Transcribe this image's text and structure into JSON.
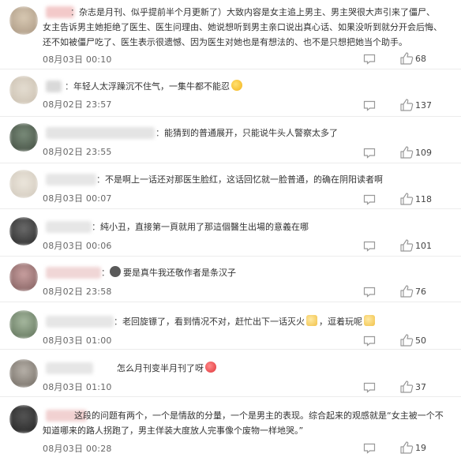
{
  "comments": [
    {
      "name_sep": "：",
      "text_lines": [
        "杂志是月刊、似乎提前半个月更新了）大致内容是女主追上男主、男主哭很大声引来了僵尸、",
        "女主告诉男主她拒绝了医生、医生问理由、她说想听到男主亲口说出真心话、如果没听到就分开会后悔、",
        "还不如被僵尸吃了、医生表示很遗憾、因为医生对她也是有想法的、也不是只想把她当个助手。"
      ],
      "date": "08月03日 00:10",
      "likes": "68"
    },
    {
      "name_sep": "：",
      "text_lines": [
        "年轻人太浮躁沉不住气，一集牛都不能忍"
      ],
      "emoji": "sad-face-emoji",
      "date": "08月02日 23:57",
      "likes": "137"
    },
    {
      "name_sep": "：",
      "text_lines": [
        "能猜到的普通展开，只能说牛头人警察太多了"
      ],
      "date": "08月02日 23:55",
      "likes": "109"
    },
    {
      "name_sep": "：",
      "text_lines": [
        "不是啊上一话还对那医生脸红，这话回忆就一脸普通，的确在阴阳读者啊"
      ],
      "date": "08月03日 00:07",
      "likes": "118"
    },
    {
      "name_sep": "：",
      "text_lines": [
        "純小丑，直接第一頁就用了那這個醫生出場的意義在哪"
      ],
      "date": "08月03日 00:06",
      "likes": "101"
    },
    {
      "name_sep": "：",
      "text_lines": [
        "要是真牛我还敬作者是条汉子"
      ],
      "date": "08月02日 23:58",
      "likes": "76"
    },
    {
      "name_sep": "：",
      "text_lines": [
        "老回旋镖了，看到情况不对，赶忙出下一话灭火",
        "，逗着玩呢"
      ],
      "date": "08月03日 01:00",
      "likes": "50"
    },
    {
      "name_sep": "：",
      "text_lines": [
        "怎么月刊变半月刊了呀"
      ],
      "date": "08月03日 01:10",
      "likes": "37"
    },
    {
      "name_sep": "：",
      "text_lines": [
        "这段的问题有两个，一个是情敌的分量，一个是男主的表现。综合起来的观感就是“女主被一个不",
        "知道哪来的路人拐跑了，男主佯装大度放人完事像个废物一样地哭。”"
      ],
      "date": "08月03日 00:28",
      "likes": "19"
    }
  ],
  "icons": {
    "comment": "comment-icon",
    "like": "thumbs-up-icon"
  }
}
